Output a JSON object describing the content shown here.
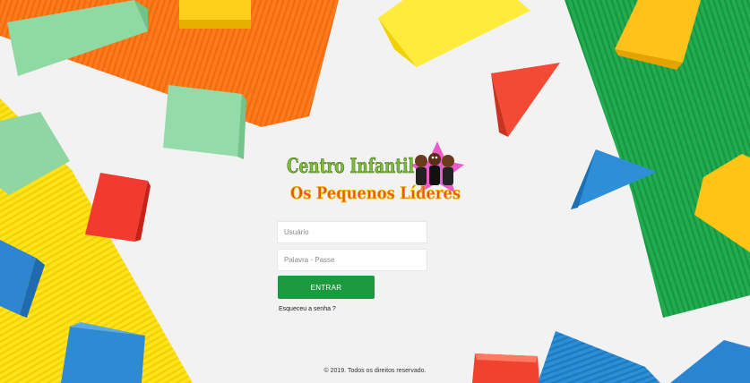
{
  "logo": {
    "line1": "Centro Infantil",
    "line2": "Os Pequenos Líderes"
  },
  "login": {
    "username_placeholder": "Usuário",
    "password_placeholder": "Palavra - Passe",
    "submit_label": "ENTRAR",
    "forgot_label": "Esqueceu a senha ?"
  },
  "footer": {
    "copyright": "© 2019. Todos os direitos reservado."
  },
  "colors": {
    "button": "#1b9a3f",
    "orange_sheet": "#ff7a1a",
    "yellow_sheet": "#ffe019",
    "green_sheet": "#1fa84f"
  }
}
